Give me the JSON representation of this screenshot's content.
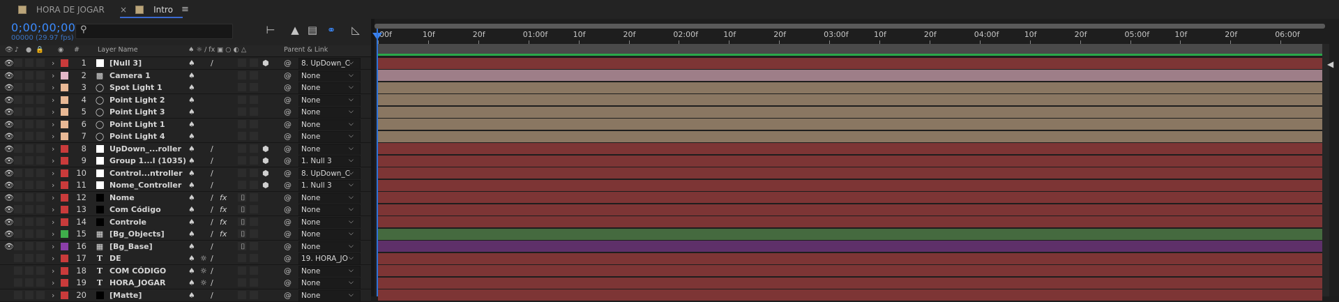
{
  "tabs": [
    {
      "label": "HORA DE JOGAR",
      "active": false
    },
    {
      "label": "Intro",
      "active": true,
      "close": "×",
      "menu": "≡"
    }
  ],
  "comp": {
    "timecode": "0;00;00;00",
    "fps_line": "00000 (29.97 fps)",
    "search_placeholder": ""
  },
  "columns": {
    "layer_name": "Layer Name",
    "number": "#",
    "parent_link": "Parent & Link"
  },
  "ruler": {
    "labels": [
      "00f",
      "10f",
      "20f",
      "01:00f",
      "10f",
      "20f",
      "02:00f",
      "10f",
      "20f",
      "03:00f",
      "10f",
      "20f",
      "04:00f",
      "10f",
      "20f",
      "05:00f",
      "10f",
      "20f",
      "06:00f"
    ]
  },
  "label_colors": {
    "red": "#c93b3b",
    "pink": "#e3b8c8",
    "peach": "#e8b895",
    "green": "#3fae4b",
    "purple": "#8b3fa8",
    "black": "#111111"
  },
  "bar_colors": {
    "red": "#7d3535",
    "pink": "#9e7e88",
    "tan": "#8a7762",
    "green": "#456a3f",
    "purple": "#5e3069"
  },
  "layers": [
    {
      "num": "1",
      "name": "[Null 3]",
      "type": "box",
      "label": "#c93b3b",
      "bar": "#7d3535",
      "parent": "8. UpDown_C",
      "eye": true,
      "sw": [
        "solo",
        "pen",
        "3d"
      ]
    },
    {
      "num": "2",
      "name": "Camera 1",
      "type": "camera",
      "label": "#e3b8c8",
      "bar": "#9e7e88",
      "parent": "None",
      "eye": true,
      "sw": [
        "solo"
      ]
    },
    {
      "num": "3",
      "name": "Spot Light 1",
      "type": "light",
      "label": "#e8b895",
      "bar": "#8a7762",
      "parent": "None",
      "eye": true,
      "sw": [
        "solo"
      ]
    },
    {
      "num": "4",
      "name": "Point Light 2",
      "type": "light",
      "label": "#e8b895",
      "bar": "#8a7762",
      "parent": "None",
      "eye": true,
      "sw": [
        "solo"
      ]
    },
    {
      "num": "5",
      "name": "Point Light 3",
      "type": "light",
      "label": "#e8b895",
      "bar": "#8a7762",
      "parent": "None",
      "eye": true,
      "sw": [
        "solo"
      ]
    },
    {
      "num": "6",
      "name": "Point Light 1",
      "type": "light",
      "label": "#e8b895",
      "bar": "#8a7762",
      "parent": "None",
      "eye": true,
      "sw": [
        "solo"
      ]
    },
    {
      "num": "7",
      "name": "Point Light 4",
      "type": "light",
      "label": "#e8b895",
      "bar": "#8a7762",
      "parent": "None",
      "eye": true,
      "sw": [
        "solo"
      ]
    },
    {
      "num": "8",
      "name": "UpDown_...roller",
      "type": "box",
      "label": "#c93b3b",
      "bar": "#7d3535",
      "parent": "None",
      "eye": true,
      "sw": [
        "solo",
        "pen",
        "3d"
      ]
    },
    {
      "num": "9",
      "name": "Group 1...l (1035)",
      "type": "box",
      "label": "#c93b3b",
      "bar": "#7d3535",
      "parent": "1. Null 3",
      "eye": true,
      "sw": [
        "solo",
        "pen",
        "3d"
      ]
    },
    {
      "num": "10",
      "name": "Control...ntroller",
      "type": "box",
      "label": "#c93b3b",
      "bar": "#7d3535",
      "parent": "8. UpDown_C",
      "eye": true,
      "sw": [
        "solo",
        "pen",
        "3d"
      ]
    },
    {
      "num": "11",
      "name": "Nome_Controller",
      "type": "box",
      "label": "#c93b3b",
      "bar": "#7d3535",
      "parent": "1. Null 3",
      "eye": true,
      "sw": [
        "solo",
        "pen",
        "3d"
      ]
    },
    {
      "num": "12",
      "name": "Nome",
      "type": "black",
      "label": "#c93b3b",
      "bar": "#7d3535",
      "parent": "None",
      "eye": true,
      "sw": [
        "solo",
        "pen",
        "fx",
        "clip"
      ]
    },
    {
      "num": "13",
      "name": "Com Código",
      "type": "black",
      "label": "#c93b3b",
      "bar": "#7d3535",
      "parent": "None",
      "eye": true,
      "sw": [
        "solo",
        "pen",
        "fx",
        "clip"
      ]
    },
    {
      "num": "14",
      "name": "Controle",
      "type": "black",
      "label": "#c93b3b",
      "bar": "#7d3535",
      "parent": "None",
      "eye": true,
      "sw": [
        "solo",
        "pen",
        "fx",
        "clip"
      ]
    },
    {
      "num": "15",
      "name": "[Bg_Objects]",
      "type": "comp",
      "label": "#3fae4b",
      "bar": "#456a3f",
      "parent": "None",
      "eye": true,
      "sw": [
        "solo",
        "pen",
        "fx",
        "clip"
      ]
    },
    {
      "num": "16",
      "name": "[Bg_Base]",
      "type": "comp",
      "label": "#8b3fa8",
      "bar": "#5e3069",
      "parent": "None",
      "eye": true,
      "sw": [
        "solo",
        "pen",
        "clip"
      ]
    },
    {
      "num": "17",
      "name": "DE",
      "type": "text",
      "label": "#c93b3b",
      "bar": "#7d3535",
      "parent": "19. HORA_JO",
      "eye": false,
      "sw": [
        "solo",
        "star",
        "pen"
      ]
    },
    {
      "num": "18",
      "name": "COM CÓDIGO",
      "type": "text",
      "label": "#c93b3b",
      "bar": "#7d3535",
      "parent": "None",
      "eye": false,
      "sw": [
        "solo",
        "star",
        "pen"
      ]
    },
    {
      "num": "19",
      "name": "HORA_JOGAR",
      "type": "text",
      "label": "#c93b3b",
      "bar": "#7d3535",
      "parent": "None",
      "eye": false,
      "sw": [
        "solo",
        "star",
        "pen"
      ]
    },
    {
      "num": "20",
      "name": "[Matte]",
      "type": "black",
      "label": "#c93b3b",
      "bar": "#7d3535",
      "parent": "None",
      "eye": false,
      "sw": [
        "solo",
        "pen"
      ]
    }
  ]
}
